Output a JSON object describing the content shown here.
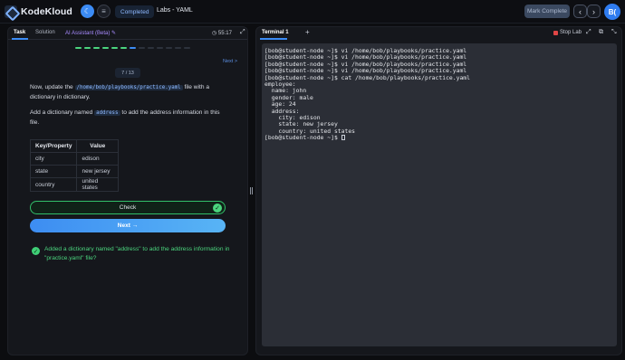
{
  "app": {
    "name": "KodeKloud",
    "status_pill": "Completed",
    "lab_title": "Labs - YAML",
    "mark_complete": "Mark Complete",
    "avatar_initial": "B("
  },
  "left": {
    "tabs": {
      "task": "Task",
      "solution": "Solution",
      "ai": "AI Assistant (Beta) ✎"
    },
    "timer": "55:17",
    "progress": {
      "done": 6,
      "total": 13
    },
    "next_link": "Next >",
    "step": "7 / 13",
    "para1_pre": "Now, update the ",
    "para1_code": "/home/bob/playbooks/practice.yaml",
    "para1_post": " file with a dictionary in dictionary.",
    "para2_pre": "Add a dictionary named ",
    "para2_code": "address",
    "para2_post": " to add the address information in this file.",
    "table": {
      "headers": [
        "Key/Property",
        "Value"
      ],
      "rows": [
        [
          "city",
          "edison"
        ],
        [
          "state",
          "new jersey"
        ],
        [
          "country",
          "united states"
        ]
      ]
    },
    "check_label": "Check",
    "next_label": "Next →",
    "result_text": "Added a dictionary named \"address\" to add the address information in \"practice.yaml\" file?"
  },
  "right": {
    "tab": "Terminal 1",
    "stop_lab": "Stop Lab",
    "terminal_lines": [
      "[bob@student-node ~]$ vi /home/bob/playbooks/practice.yaml",
      "[bob@student-node ~]$ vi /home/bob/playbooks/practice.yaml",
      "[bob@student-node ~]$ vi /home/bob/playbooks/practice.yaml",
      "[bob@student-node ~]$ vi /home/bob/playbooks/practice.yaml",
      "[bob@student-node ~]$ cat /home/bob/playbooks/practice.yaml",
      "employee:",
      "  name: john",
      "  gender: male",
      "  age: 24",
      "  address:",
      "    city: edison",
      "    state: new jersey",
      "    country: united states"
    ],
    "prompt": "[bob@student-node ~]$ "
  },
  "colors": {
    "accent": "#3c8cf5",
    "success": "#4bd57e",
    "ai": "#a88bff"
  }
}
